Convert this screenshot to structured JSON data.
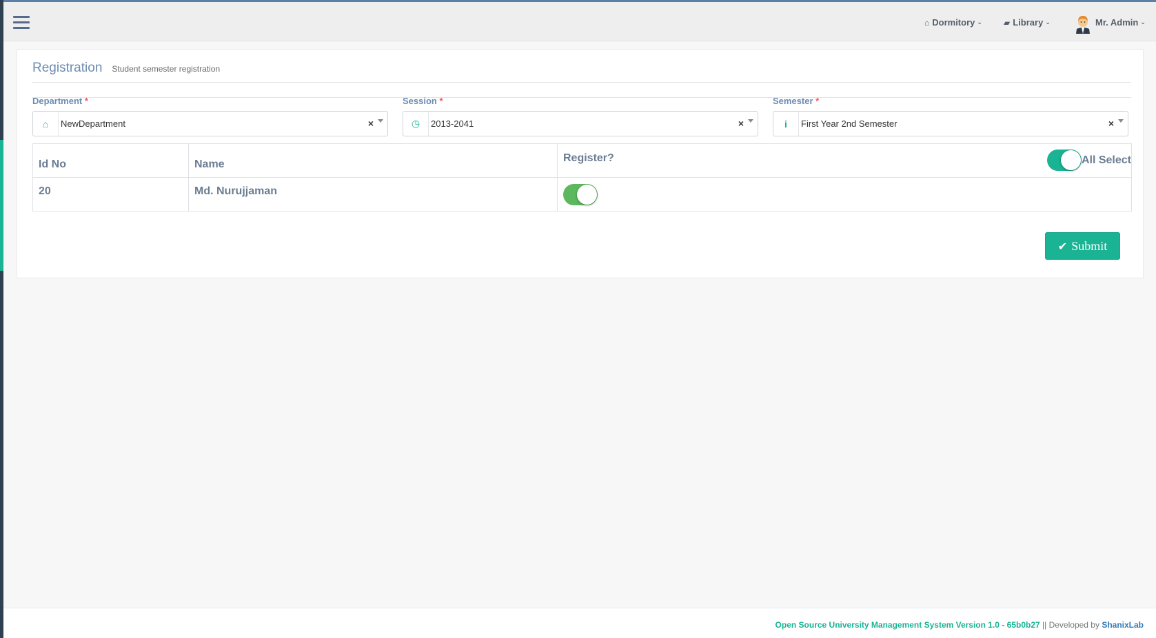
{
  "navbar": {
    "dormitory": "Dormitory",
    "library": "Library",
    "user": "Mr. Admin"
  },
  "panel": {
    "title": "Registration",
    "subtitle": "Student semester registration"
  },
  "filters": {
    "department": {
      "label": "Department",
      "required": "*",
      "value": "NewDepartment",
      "clear": "×"
    },
    "session": {
      "label": "Session",
      "required": "*",
      "value": "2013-2041",
      "clear": "×"
    },
    "semester": {
      "label": "Semester",
      "required": "*",
      "value": "First Year 2nd Semester",
      "clear": "×"
    }
  },
  "table": {
    "headers": {
      "id": "Id No",
      "name": "Name",
      "register": "Register?",
      "all_select": "All Select"
    },
    "all_select_on": true,
    "rows": [
      {
        "id": "20",
        "name": "Md. Nurujjaman",
        "registered": true
      }
    ]
  },
  "submit_label": "Submit",
  "footer": {
    "system": "Open Source University Management System Version 1.0 - 65b0b27",
    "separator": " || Developed by ",
    "developer": "ShanixLab"
  },
  "colors": {
    "accent": "#1ab394",
    "toggle_on": "#5cb85c",
    "heading": "#6b8cb3",
    "required": "#ed5565"
  }
}
